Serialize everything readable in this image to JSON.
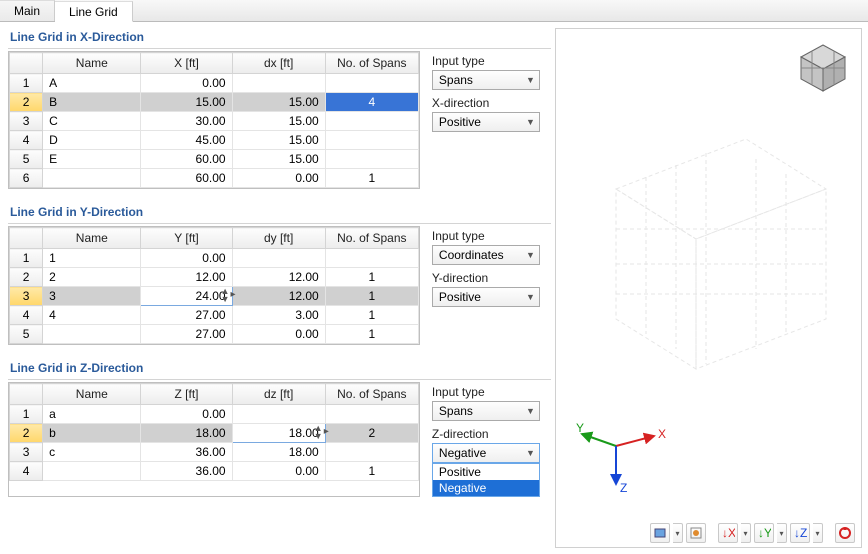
{
  "tabs": {
    "main": "Main",
    "linegrid": "Line Grid"
  },
  "sections": {
    "x": {
      "title": "Line Grid in X-Direction",
      "cols": [
        "Name",
        "X [ft]",
        "dx [ft]",
        "No. of Spans"
      ],
      "rows": [
        {
          "i": "1",
          "name": "A",
          "v": "0.00",
          "d": "",
          "n": ""
        },
        {
          "i": "2",
          "name": "B",
          "v": "15.00",
          "d": "15.00",
          "n": "4"
        },
        {
          "i": "3",
          "name": "C",
          "v": "30.00",
          "d": "15.00",
          "n": ""
        },
        {
          "i": "4",
          "name": "D",
          "v": "45.00",
          "d": "15.00",
          "n": ""
        },
        {
          "i": "5",
          "name": "E",
          "v": "60.00",
          "d": "15.00",
          "n": ""
        },
        {
          "i": "6",
          "name": "",
          "v": "60.00",
          "d": "0.00",
          "n": "1"
        }
      ],
      "input_label": "Input type",
      "input_val": "Spans",
      "dir_label": "X-direction",
      "dir_val": "Positive"
    },
    "y": {
      "title": "Line Grid in Y-Direction",
      "cols": [
        "Name",
        "Y [ft]",
        "dy [ft]",
        "No. of Spans"
      ],
      "rows": [
        {
          "i": "1",
          "name": "1",
          "v": "0.00",
          "d": "",
          "n": ""
        },
        {
          "i": "2",
          "name": "2",
          "v": "12.00",
          "d": "12.00",
          "n": "1"
        },
        {
          "i": "3",
          "name": "3",
          "v": "24.00",
          "d": "12.00",
          "n": "1"
        },
        {
          "i": "4",
          "name": "4",
          "v": "27.00",
          "d": "3.00",
          "n": "1"
        },
        {
          "i": "5",
          "name": "",
          "v": "27.00",
          "d": "0.00",
          "n": "1"
        }
      ],
      "input_label": "Input type",
      "input_val": "Coordinates",
      "dir_label": "Y-direction",
      "dir_val": "Positive"
    },
    "z": {
      "title": "Line Grid in Z-Direction",
      "cols": [
        "Name",
        "Z [ft]",
        "dz [ft]",
        "No. of Spans"
      ],
      "rows": [
        {
          "i": "1",
          "name": "a",
          "v": "0.00",
          "d": "",
          "n": ""
        },
        {
          "i": "2",
          "name": "b",
          "v": "18.00",
          "d": "18.00",
          "n": "2"
        },
        {
          "i": "3",
          "name": "c",
          "v": "36.00",
          "d": "18.00",
          "n": ""
        },
        {
          "i": "4",
          "name": "",
          "v": "36.00",
          "d": "0.00",
          "n": "1"
        }
      ],
      "input_label": "Input type",
      "input_val": "Spans",
      "dir_label": "Z-direction",
      "dir_val": "Negative",
      "dir_opts": [
        "Positive",
        "Negative"
      ]
    }
  },
  "axis": {
    "x": "X",
    "y": "Y",
    "z": "Z"
  },
  "y_edit_value": "24.00",
  "z_edit_value": "18.00"
}
